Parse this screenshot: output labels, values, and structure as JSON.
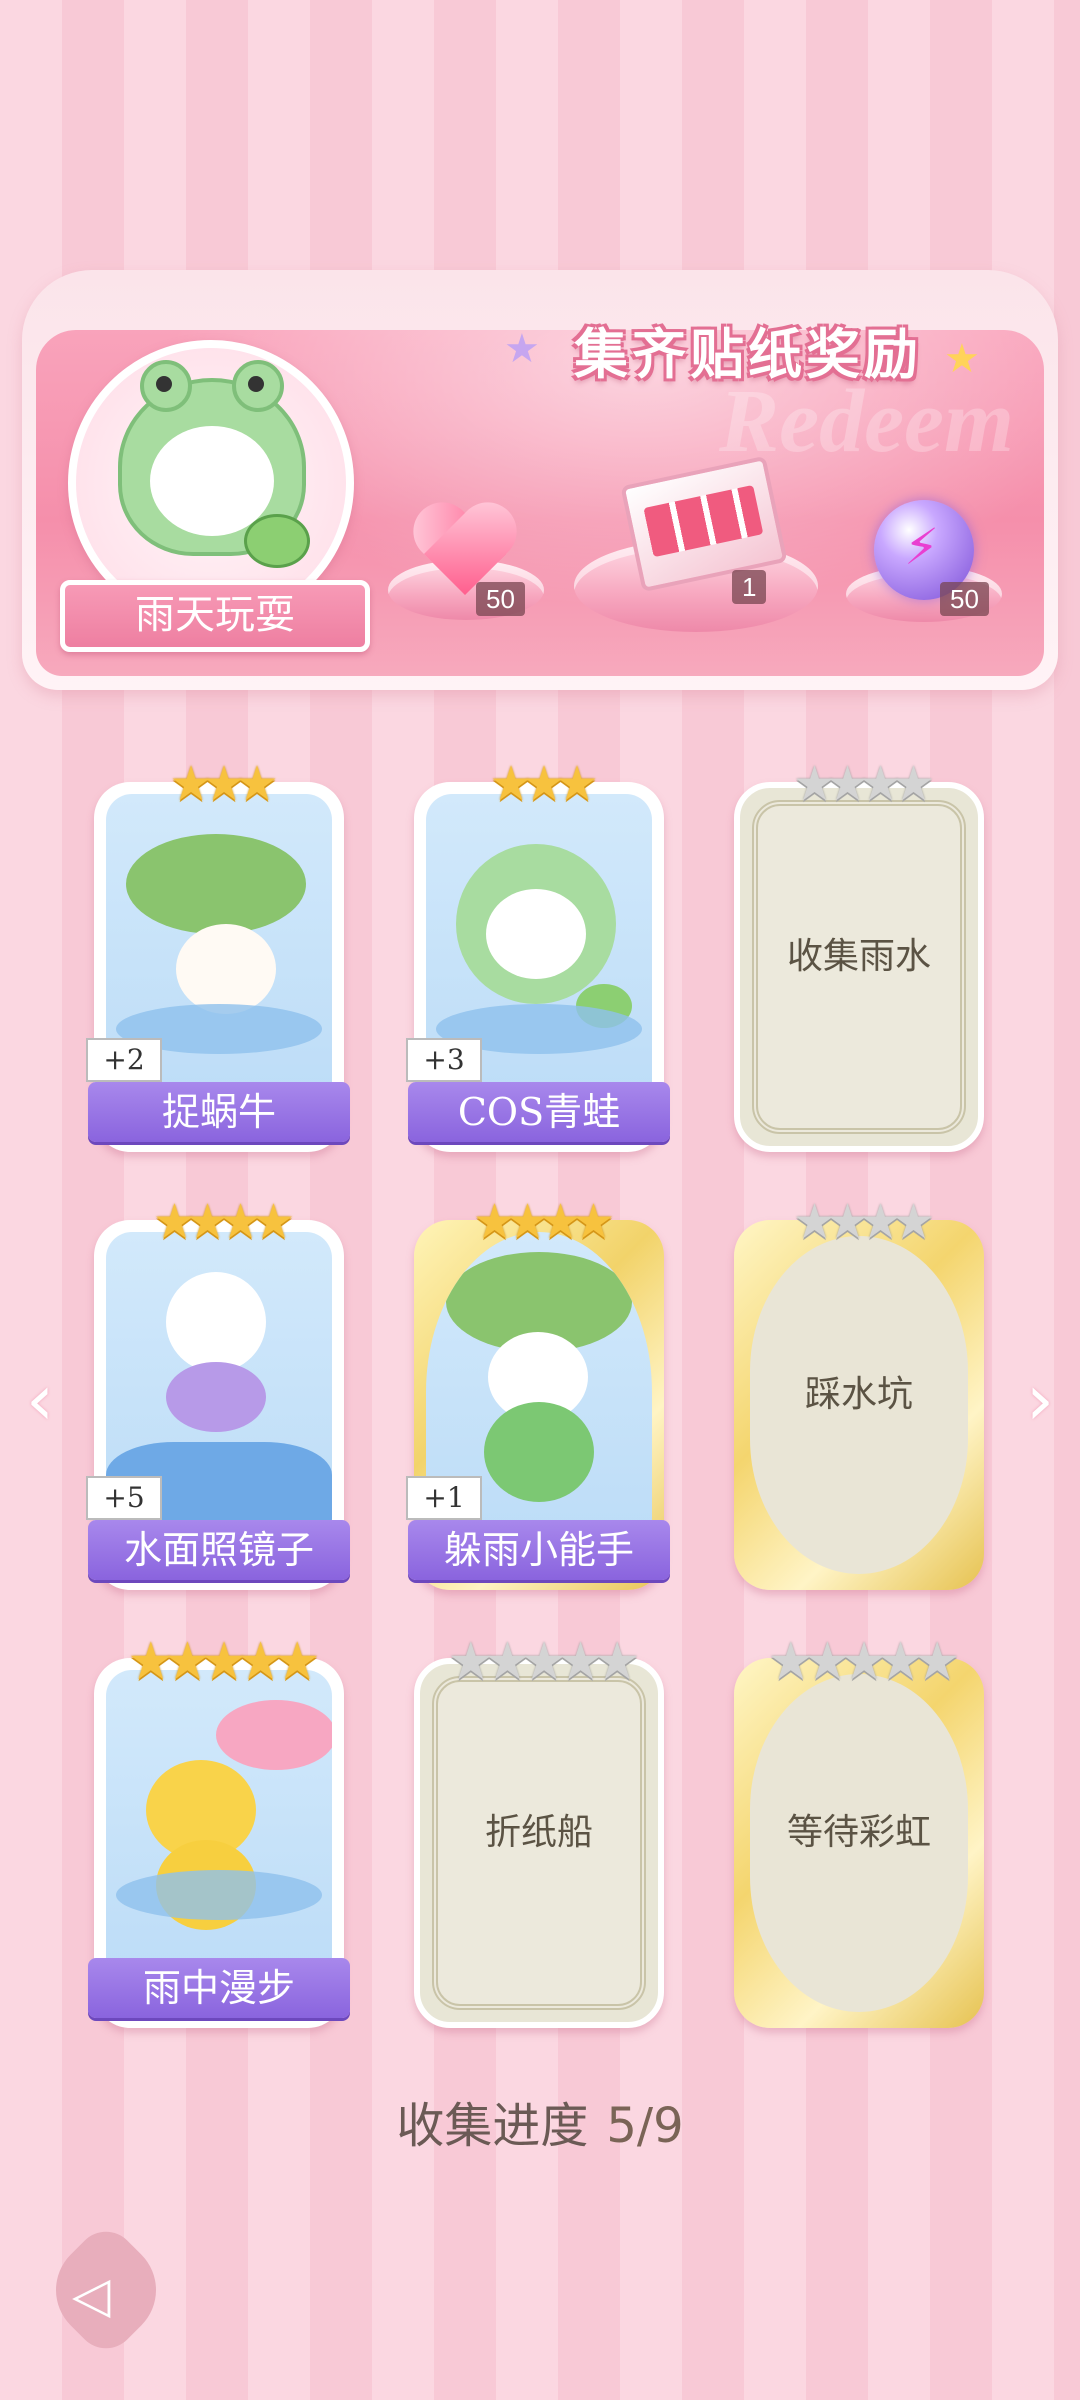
{
  "banner": {
    "title": "集齐贴纸奖励",
    "watermark": "Redeem",
    "theme_name": "雨天玩耍",
    "rewards": [
      {
        "icon": "pink-heart-gem-icon",
        "count": "50"
      },
      {
        "icon": "gift-box-icon",
        "count": "1"
      },
      {
        "icon": "purple-energy-orb-icon",
        "count": "50"
      }
    ]
  },
  "cards": [
    {
      "name": "捉蜗牛",
      "stars": "★★★",
      "star_count": 3,
      "unlocked": true,
      "bonus": "+2"
    },
    {
      "name": "COS青蛙",
      "stars": "★★★",
      "star_count": 3,
      "unlocked": true,
      "bonus": "+3"
    },
    {
      "name": "收集雨水",
      "stars": "★★★★",
      "star_count": 4,
      "unlocked": false
    },
    {
      "name": "水面照镜子",
      "stars": "★★★★",
      "star_count": 4,
      "unlocked": true,
      "bonus": "+5"
    },
    {
      "name": "躲雨小能手",
      "stars": "★★★★",
      "star_count": 4,
      "unlocked": true,
      "bonus": "+1"
    },
    {
      "name": "踩水坑",
      "stars": "★★★★",
      "star_count": 4,
      "unlocked": false
    },
    {
      "name": "雨中漫步",
      "stars": "★★★★★",
      "star_count": 5,
      "unlocked": true
    },
    {
      "name": "折纸船",
      "stars": "★★★★★",
      "star_count": 5,
      "unlocked": false
    },
    {
      "name": "等待彩虹",
      "stars": "★★★★★",
      "star_count": 5,
      "unlocked": false
    }
  ],
  "nav": {
    "left": "‹",
    "right": "›",
    "back": "◁"
  },
  "progress": {
    "label": "收集进度",
    "value": "5/9",
    "collected": 5,
    "total": 9
  },
  "colors": {
    "accent_pink": "#f58fab",
    "label_purple": "#8a64de",
    "star_gold": "#f7c23e",
    "star_grey": "#d4d4d4"
  }
}
